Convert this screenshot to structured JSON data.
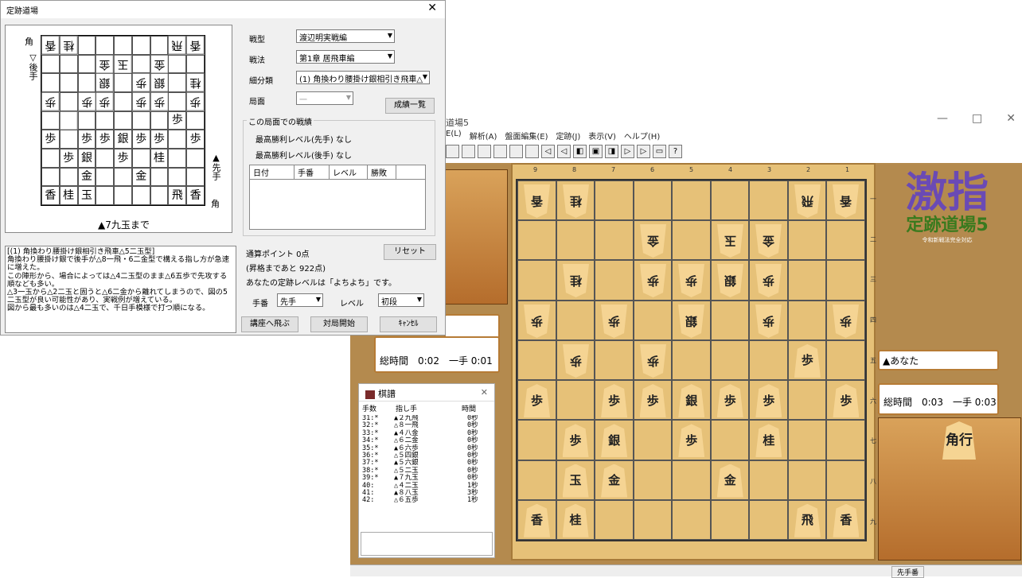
{
  "dialog": {
    "title": "定跡道場",
    "close": "✕",
    "mini_gote_label": "▽後手",
    "mini_gote_hand": "角",
    "mini_sente_label": "▲先手",
    "mini_sente_hand": "角",
    "mini_caption": "▲7九玉まで",
    "labels": {
      "type": "戦型",
      "tactic": "戦法",
      "sub": "細分類",
      "position": "局面"
    },
    "type_value": "渡辺明実戦編",
    "tactic_value": "第1章 居飛車編",
    "sub_value": "(1) 角換わり腰掛け銀相引き飛車△",
    "position_value": "一",
    "results_button": "成績一覧",
    "record_group": "この局面での戦績",
    "best_sente": "最高勝利レベル(先手) なし",
    "best_gote": "最高勝利レベル(後手) なし",
    "record_cols": [
      "日付",
      "手番",
      "レベル",
      "勝敗"
    ],
    "points": "通算ポイント 0点",
    "reset": "リセット",
    "next": "(昇格まであと 922点)",
    "level_text": "あなたの定跡レベルは「よちよち」です。",
    "turn_label": "手番",
    "turn_value": "先手",
    "level_label": "レベル",
    "level_value": "初段",
    "goto_course": "講座へ飛ぶ",
    "start": "対局開始",
    "cancel": "ｷｬﾝｾﾙ",
    "comment": "[(1) 角換わり腰掛け銀相引き飛車△5二玉型]\n角換わり腰掛け銀で後手が△8一飛・6二金型で構える指し方が急速に増えた。\nこの陣形から、場合によっては△4二玉型のまま△6五歩で先攻する順なども多い。\n△3一玉から△2二玉と固うと△6二金から離れてしまうので、図の5二玉型が良い可能性があり、実戦例が増えている。\n図から最も多いのは△4二玉で、千日手模様で打つ順になる。"
  },
  "mini_board": [
    [
      "香",
      "桂",
      "",
      "",
      "",
      "",
      "",
      "飛",
      "香"
    ],
    [
      "",
      "",
      "",
      "金",
      "玉",
      "",
      "金",
      "",
      ""
    ],
    [
      "",
      "",
      "",
      "銀",
      "",
      "歩",
      "銀",
      "",
      "桂"
    ],
    [
      "歩",
      "",
      "歩",
      "歩",
      "",
      "歩",
      "歩",
      "",
      "歩"
    ],
    [
      "",
      "",
      "",
      "",
      "",
      "",
      "",
      "歩",
      ""
    ],
    [
      "歩",
      "",
      "歩",
      "歩",
      "銀",
      "歩",
      "歩",
      "",
      "歩"
    ],
    [
      "",
      "歩",
      "銀",
      "",
      "歩",
      "",
      "桂",
      "",
      ""
    ],
    [
      "",
      "",
      "金",
      "",
      "",
      "金",
      "",
      "",
      ""
    ],
    [
      "香",
      "桂",
      "玉",
      "",
      "",
      "",
      "",
      "飛",
      "香"
    ]
  ],
  "mini_gote": [
    [
      1,
      1,
      0,
      0,
      0,
      0,
      0,
      1,
      1
    ],
    [
      0,
      0,
      0,
      1,
      1,
      0,
      1,
      0,
      0
    ],
    [
      0,
      0,
      0,
      1,
      0,
      1,
      1,
      0,
      1
    ],
    [
      1,
      0,
      1,
      1,
      0,
      1,
      1,
      0,
      1
    ],
    [
      0,
      1,
      0,
      0,
      0,
      0,
      0,
      0,
      0
    ],
    [
      0,
      0,
      0,
      0,
      0,
      0,
      0,
      0,
      0
    ],
    [
      0,
      0,
      0,
      0,
      0,
      0,
      0,
      0,
      0
    ],
    [
      0,
      0,
      0,
      0,
      0,
      0,
      0,
      0,
      0
    ],
    [
      0,
      0,
      0,
      0,
      0,
      0,
      0,
      0,
      0
    ]
  ],
  "main": {
    "title": "道場5",
    "menu": [
      "E(L)",
      "解析(A)",
      "盤面編集(E)",
      "定跡(J)",
      "表示(V)",
      "ヘルプ(H)"
    ],
    "cols": [
      "9",
      "8",
      "7",
      "6",
      "5",
      "4",
      "3",
      "2",
      "1"
    ],
    "rows": [
      "一",
      "二",
      "三",
      "四",
      "五",
      "六",
      "七",
      "八",
      "九"
    ],
    "logo_big": "激指",
    "logo_sub": "定跡道場5",
    "logo_tag": "令和新戦法完全対応",
    "gote_time": "総時間　0:02　一手 0:01",
    "sente_name": "▲あなた",
    "sente_time": "総時間　0:03　一手 0:03",
    "sente_hand": "角行",
    "status": "先手番"
  },
  "board": [
    [
      "香",
      "桂",
      "",
      "",
      "",
      "",
      "",
      "飛",
      "香"
    ],
    [
      "",
      "",
      "",
      "金",
      "",
      "玉",
      "金",
      "",
      ""
    ],
    [
      "",
      "桂",
      "",
      "歩",
      "歩",
      "銀",
      "歩",
      "",
      ""
    ],
    [
      "歩",
      "",
      "歩",
      "",
      "銀",
      "",
      "歩",
      "",
      "歩"
    ],
    [
      "",
      "歩",
      "",
      "歩",
      "",
      "",
      "",
      "歩",
      ""
    ],
    [
      "歩",
      "",
      "歩",
      "歩",
      "銀",
      "歩",
      "歩",
      "",
      "歩"
    ],
    [
      "",
      "歩",
      "銀",
      "",
      "歩",
      "",
      "桂",
      "",
      ""
    ],
    [
      "",
      "玉",
      "金",
      "",
      "",
      "金",
      "",
      "",
      ""
    ],
    [
      "香",
      "桂",
      "",
      "",
      "",
      "",
      "",
      "飛",
      "香"
    ]
  ],
  "gote": [
    [
      1,
      1,
      0,
      0,
      0,
      0,
      0,
      1,
      1
    ],
    [
      0,
      0,
      0,
      1,
      0,
      1,
      1,
      0,
      0
    ],
    [
      0,
      1,
      0,
      1,
      1,
      1,
      1,
      1,
      0
    ],
    [
      1,
      0,
      1,
      0,
      1,
      0,
      1,
      0,
      1
    ],
    [
      0,
      1,
      0,
      1,
      0,
      0,
      0,
      0,
      0
    ],
    [
      0,
      0,
      0,
      0,
      0,
      0,
      0,
      0,
      0
    ],
    [
      0,
      0,
      0,
      0,
      0,
      0,
      0,
      0,
      0
    ],
    [
      0,
      0,
      0,
      0,
      0,
      0,
      0,
      0,
      0
    ],
    [
      0,
      0,
      0,
      0,
      0,
      0,
      0,
      0,
      0
    ]
  ],
  "kifu": {
    "title": "棋譜",
    "h1": "手数",
    "h2": "指し手",
    "h3": "時間",
    "moves": [
      [
        "31:*",
        "▲２九飛",
        "0秒"
      ],
      [
        "32:*",
        "△８一飛",
        "0秒"
      ],
      [
        "33:*",
        "▲４八金",
        "0秒"
      ],
      [
        "34:*",
        "△６二金",
        "0秒"
      ],
      [
        "35:*",
        "▲６六歩",
        "0秒"
      ],
      [
        "36:*",
        "△５四銀",
        "0秒"
      ],
      [
        "37:*",
        "▲５六銀",
        "0秒"
      ],
      [
        "38:*",
        "△５二玉",
        "0秒"
      ],
      [
        "39:*",
        "▲７九玉",
        "0秒"
      ],
      [
        "40:",
        "△４二玉",
        "1秒"
      ],
      [
        "41:",
        "▲８八玉",
        "3秒"
      ],
      [
        "42:",
        "△６五歩",
        "1秒"
      ]
    ]
  }
}
